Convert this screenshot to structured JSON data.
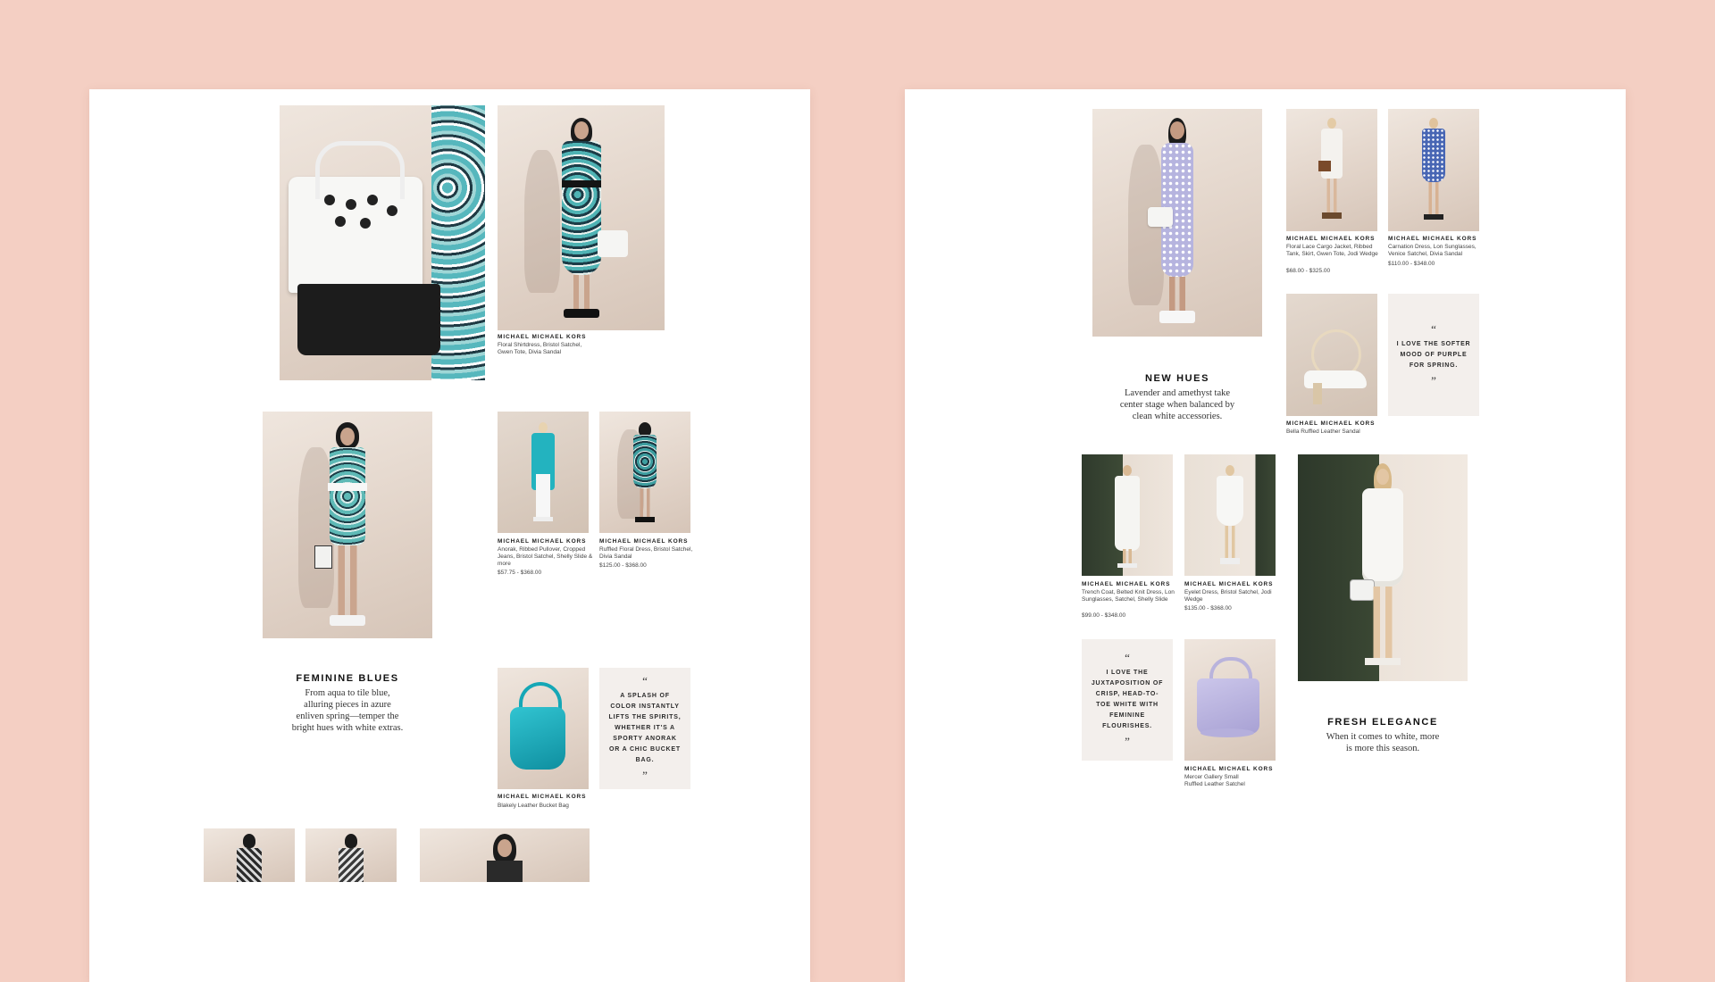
{
  "brand": "MICHAEL MICHAEL KORS",
  "colors": {
    "background": "#f4cfc3",
    "page": "#ffffff",
    "quote_card": "#f3efec",
    "teal": "#1aa9b8",
    "lavender": "#b9b6e0"
  },
  "left_page": {
    "looks": [
      {
        "desc": "Floral Shirtdress, Bristol Satchel, Gwen Tote, Divia Sandal",
        "price": ""
      },
      {
        "desc": "Anorak, Ribbed Pullover, Cropped Jeans, Bristol Satchel, Shelly Slide & more",
        "price": "$57.75 - $368.00"
      },
      {
        "desc": "Ruffled Floral Dress, Bristol Satchel, Divia Sandal",
        "price": "$125.00 - $368.00"
      },
      {
        "desc": "Blakely Leather Bucket Bag",
        "price": ""
      }
    ],
    "quote": "A SPLASH OF COLOR INSTANTLY LIFTS THE SPIRITS, WHETHER IT'S A SPORTY ANORAK OR A CHIC BUCKET BAG.",
    "section": {
      "title": "FEMININE BLUES",
      "body": "From aqua to tile blue, alluring pieces in azure enliven spring—temper the bright hues with white extras."
    }
  },
  "right_page": {
    "looks": [
      {
        "desc": "Floral Lace Cargo Jacket, Ribbed Tank, Skirt, Gwen Tote, Jodi Wedge",
        "price": "$68.00 - $325.00"
      },
      {
        "desc": "Carnation Dress, Lon Sunglasses, Venice Satchel, Divia Sandal",
        "price": "$110.00 - $348.00"
      },
      {
        "desc": "Bella Ruffled Leather Sandal",
        "price": ""
      },
      {
        "desc": "Trench Coat, Belted Knit Dress, Lon Sunglasses, Satchel, Shelly Slide",
        "price": "$99.00 - $348.00"
      },
      {
        "desc": "Eyelet Dress, Bristol Satchel, Jodi Wedge",
        "price": "$135.00 - $368.00"
      },
      {
        "desc": "Mercer Gallery Small Ruffled Leather Satchel",
        "price": ""
      }
    ],
    "quotes": [
      "I LOVE THE SOFTER MOOD OF PURPLE FOR SPRING.",
      "I LOVE THE JUXTAPOSITION OF CRISP, HEAD-TO-TOE WHITE WITH FEMININE FLOURISHES."
    ],
    "sections": [
      {
        "title": "NEW HUES",
        "body": "Lavender and amethyst take center stage when balanced by clean white accessories."
      },
      {
        "title": "FRESH ELEGANCE",
        "body": "When it comes to white, more is more this season."
      }
    ]
  },
  "quote_open": "“",
  "quote_close": "”"
}
